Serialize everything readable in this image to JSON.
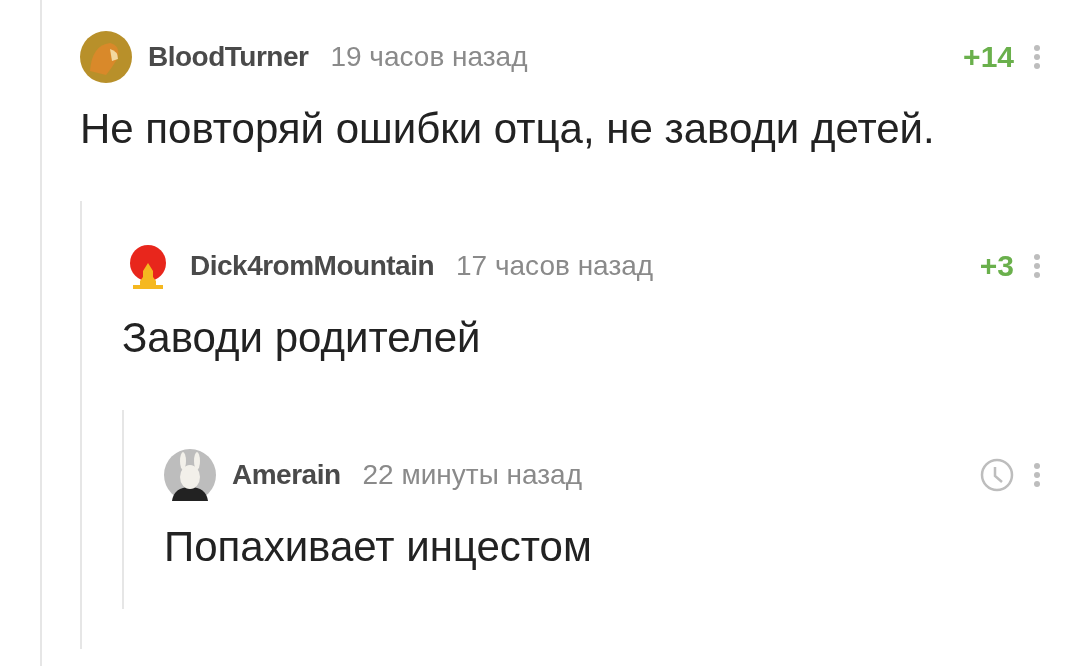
{
  "comments": [
    {
      "author": "BloodTurner",
      "avatar": {
        "kind": "lion"
      },
      "time": "19 часов назад",
      "rating": {
        "kind": "score",
        "value": "+14"
      },
      "text": "Не повторяй ошибки отца, не заводи детей.",
      "children": [
        {
          "author": "Dick4romMountain",
          "avatar": {
            "kind": "sun"
          },
          "time": "17 часов назад",
          "rating": {
            "kind": "score",
            "value": "+3"
          },
          "text": "Заводи родителей",
          "children": [
            {
              "author": "Amerain",
              "avatar": {
                "kind": "rabbit"
              },
              "time": "22 минуты назад",
              "rating": {
                "kind": "pending"
              },
              "text": "Попахивает инцестом"
            }
          ]
        }
      ]
    }
  ]
}
